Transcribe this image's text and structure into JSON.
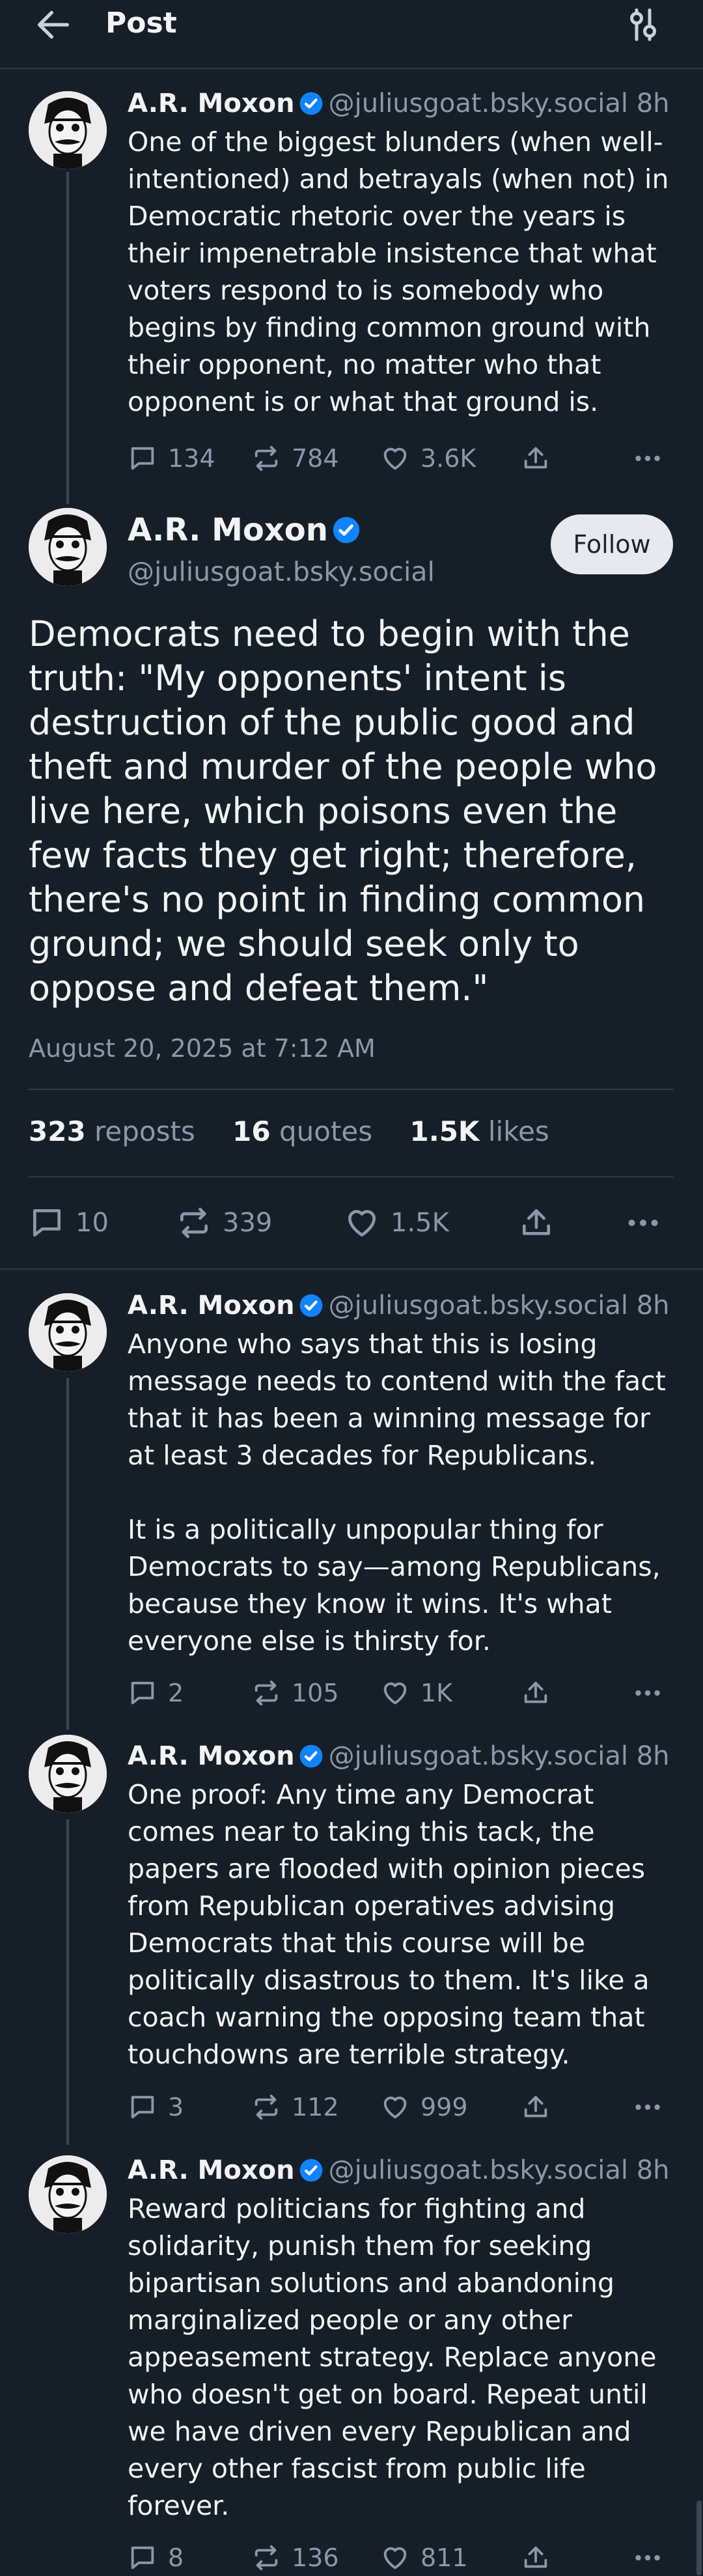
{
  "header": {
    "title": "Post"
  },
  "parent_post": {
    "author_name": "A.R. Moxon",
    "handle": "@juliusgoat.bsky.social",
    "time": "8h",
    "text": "One of the biggest blunders (when well-intentioned) and betrayals (when not) in Democratic rhetoric over the years is their impenetrable insistence that what voters respond to is somebody who begins by finding common ground with their opponent, no matter who that opponent is or what that ground is.",
    "replies": "134",
    "reposts": "784",
    "likes": "3.6K"
  },
  "main_post": {
    "author_name": "A.R. Moxon",
    "handle": "@juliusgoat.bsky.social",
    "follow_label": "Follow",
    "text": "Democrats need to begin with the truth: \"My opponents' intent is destruction of the public good and theft and murder of the people who live here, which poisons even the few facts they get right; therefore, there's no point in finding common ground; we should seek only to oppose and defeat them.\"",
    "date": "August 20, 2025 at 7:12 AM",
    "reposts_count": "323",
    "reposts_label": "reposts",
    "quotes_count": "16",
    "quotes_label": "quotes",
    "likes_count": "1.5K",
    "likes_label": "likes",
    "replies": "10",
    "reposts": "339",
    "likes": "1.5K"
  },
  "replies": [
    {
      "author_name": "A.R. Moxon",
      "handle": "@juliusgoat.bsky.social",
      "time": "8h",
      "text": "Anyone who says that this is losing message needs to contend with the fact that it has been a winning message for at least 3 decades for Republicans.\n\nIt is a politically unpopular thing for Democrats to say—among Republicans, because they know it wins. It's what everyone else is thirsty for.",
      "replies": "2",
      "reposts": "105",
      "likes": "1K"
    },
    {
      "author_name": "A.R. Moxon",
      "handle": "@juliusgoat.bsky.social",
      "time": "8h",
      "text": "One proof: Any time any Democrat comes near to taking this tack, the papers are flooded with opinion pieces from Republican operatives advising Democrats that this course will be politically disastrous to them. It's like a coach warning the opposing team that touchdowns are terrible strategy.",
      "replies": "3",
      "reposts": "112",
      "likes": "999"
    },
    {
      "author_name": "A.R. Moxon",
      "handle": "@juliusgoat.bsky.social",
      "time": "8h",
      "text": "Reward politicians for fighting and solidarity, punish them for seeking bipartisan solutions and abandoning marginalized people or any other appeasement strategy. Replace anyone who doesn't get on board. Repeat until we have driven every Republican and every other fascist from public life forever.",
      "replies": "8",
      "reposts": "136",
      "likes": "811"
    }
  ],
  "colors": {
    "background": "#161e27",
    "muted": "#8b98a9",
    "verified": "#1083fe",
    "divider": "#2e3a48"
  },
  "icons": [
    "back-arrow-icon",
    "settings-sliders-icon",
    "verified-badge-icon",
    "reply-icon",
    "repost-icon",
    "like-icon",
    "share-icon",
    "more-icon"
  ]
}
